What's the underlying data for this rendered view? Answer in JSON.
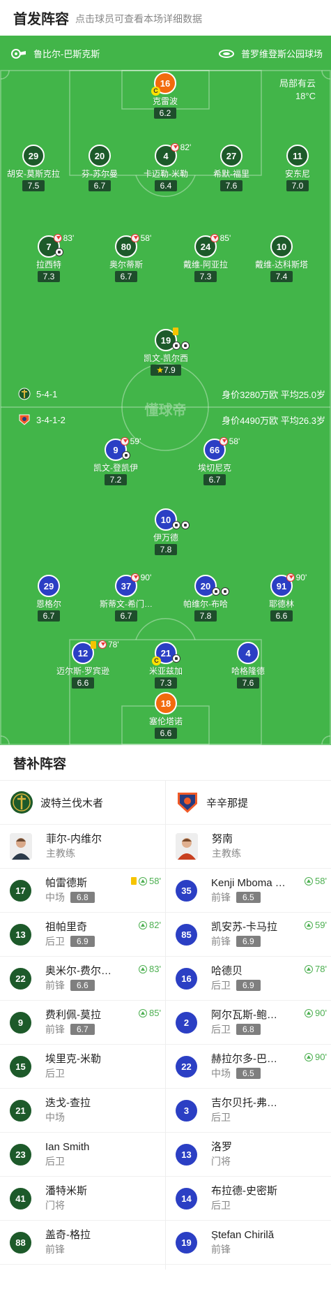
{
  "header": {
    "title": "首发阵容",
    "subtitle": "点击球员可查看本场详细数据"
  },
  "match_info": {
    "referee": "鲁比尔-巴斯克斯",
    "stadium": "普罗维登斯公园球场",
    "weather": "局部有云",
    "temperature": "18°C"
  },
  "pitch_watermark": "懂球帝",
  "home_team": {
    "formation": "5-4-1",
    "value": "身价3280万欧 平均25.0岁"
  },
  "away_team": {
    "formation": "3-4-1-2",
    "value": "身价4490万欧 平均26.3岁"
  },
  "home_players": [
    {
      "num": "16",
      "name": "克雷波",
      "rating": "6.2",
      "captain": "C"
    },
    {
      "num": "29",
      "name": "胡安-莫斯克拉",
      "rating": "7.5"
    },
    {
      "num": "20",
      "name": "芬-苏尔曼",
      "rating": "6.7"
    },
    {
      "num": "4",
      "name": "卡迈勒-米勒",
      "rating": "6.4",
      "sub": "82'"
    },
    {
      "num": "27",
      "name": "希默-福里",
      "rating": "7.6"
    },
    {
      "num": "11",
      "name": "安东尼",
      "rating": "7.0"
    },
    {
      "num": "7",
      "name": "拉西特",
      "rating": "7.3",
      "sub": "83'"
    },
    {
      "num": "80",
      "name": "奥尔蒂斯",
      "rating": "6.7",
      "sub": "58'"
    },
    {
      "num": "24",
      "name": "戴维-阿亚拉",
      "rating": "7.3",
      "sub": "85'"
    },
    {
      "num": "10",
      "name": "戴维-达科斯塔",
      "rating": "7.4"
    },
    {
      "num": "19",
      "name": "凯文-凯尔西",
      "rating": "7.9"
    }
  ],
  "away_players": [
    {
      "num": "9",
      "name": "凯文-登凯伊",
      "rating": "7.2",
      "sub": "59'"
    },
    {
      "num": "66",
      "name": "埃切尼克",
      "rating": "6.7",
      "sub": "58'"
    },
    {
      "num": "10",
      "name": "伊万德",
      "rating": "7.8"
    },
    {
      "num": "29",
      "name": "恩格尔",
      "rating": "6.7"
    },
    {
      "num": "37",
      "name": "斯蒂文-希门…",
      "rating": "6.7",
      "sub": "90'"
    },
    {
      "num": "20",
      "name": "帕维尔-布哈",
      "rating": "7.8"
    },
    {
      "num": "91",
      "name": "耶德林",
      "rating": "6.6",
      "sub": "90'"
    },
    {
      "num": "12",
      "name": "迈尔斯-罗宾逊",
      "rating": "6.6",
      "sub": "78'"
    },
    {
      "num": "21",
      "name": "米亚兹加",
      "rating": "7.3",
      "captain": "C"
    },
    {
      "num": "4",
      "name": "哈格隆德",
      "rating": "7.6"
    },
    {
      "num": "18",
      "name": "塞伦塔诺",
      "rating": "6.6"
    }
  ],
  "substitutes": {
    "title": "替补阵容",
    "home": {
      "team": "波特兰伐木者",
      "coach": {
        "name": "菲尔-内维尔",
        "role": "主教练"
      },
      "players": [
        {
          "num": "17",
          "name": "帕雷德斯",
          "pos": "中场",
          "rating": "6.8",
          "in": "58'"
        },
        {
          "num": "13",
          "name": "祖帕里奇",
          "pos": "后卫",
          "rating": "6.9",
          "in": "82'"
        },
        {
          "num": "22",
          "name": "奥米尔-费尔…",
          "pos": "前锋",
          "rating": "6.6",
          "in": "83'"
        },
        {
          "num": "9",
          "name": "费利佩-莫拉",
          "pos": "前锋",
          "rating": "6.7",
          "in": "85'"
        },
        {
          "num": "15",
          "name": "埃里克-米勒",
          "pos": "后卫"
        },
        {
          "num": "21",
          "name": "迭戈-查拉",
          "pos": "中场"
        },
        {
          "num": "23",
          "name": "Ian Smith",
          "pos": "后卫"
        },
        {
          "num": "41",
          "name": "潘特米斯",
          "pos": "门将"
        },
        {
          "num": "88",
          "name": "盖奇-格拉",
          "pos": "前锋"
        }
      ]
    },
    "away": {
      "team": "辛辛那提",
      "coach": {
        "name": "努南",
        "role": "主教练"
      },
      "players": [
        {
          "num": "35",
          "name": "Kenji Mboma …",
          "pos": "前锋",
          "rating": "6.5",
          "in": "58'"
        },
        {
          "num": "85",
          "name": "凯安苏-卡马拉",
          "pos": "前锋",
          "rating": "6.9",
          "in": "59'"
        },
        {
          "num": "16",
          "name": "哈德贝",
          "pos": "后卫",
          "rating": "6.9",
          "in": "78'"
        },
        {
          "num": "2",
          "name": "阿尔瓦斯-鲍…",
          "pos": "后卫",
          "rating": "6.8",
          "in": "90'"
        },
        {
          "num": "22",
          "name": "赫拉尔多-巴…",
          "pos": "中场",
          "rating": "6.5",
          "in": "90'"
        },
        {
          "num": "3",
          "name": "吉尔贝托-弗…",
          "pos": "后卫"
        },
        {
          "num": "13",
          "name": "洛罗",
          "pos": "门将"
        },
        {
          "num": "14",
          "name": "布拉德-史密斯",
          "pos": "后卫"
        },
        {
          "num": "19",
          "name": "Ștefan Chirilă",
          "pos": "前锋"
        }
      ]
    }
  }
}
